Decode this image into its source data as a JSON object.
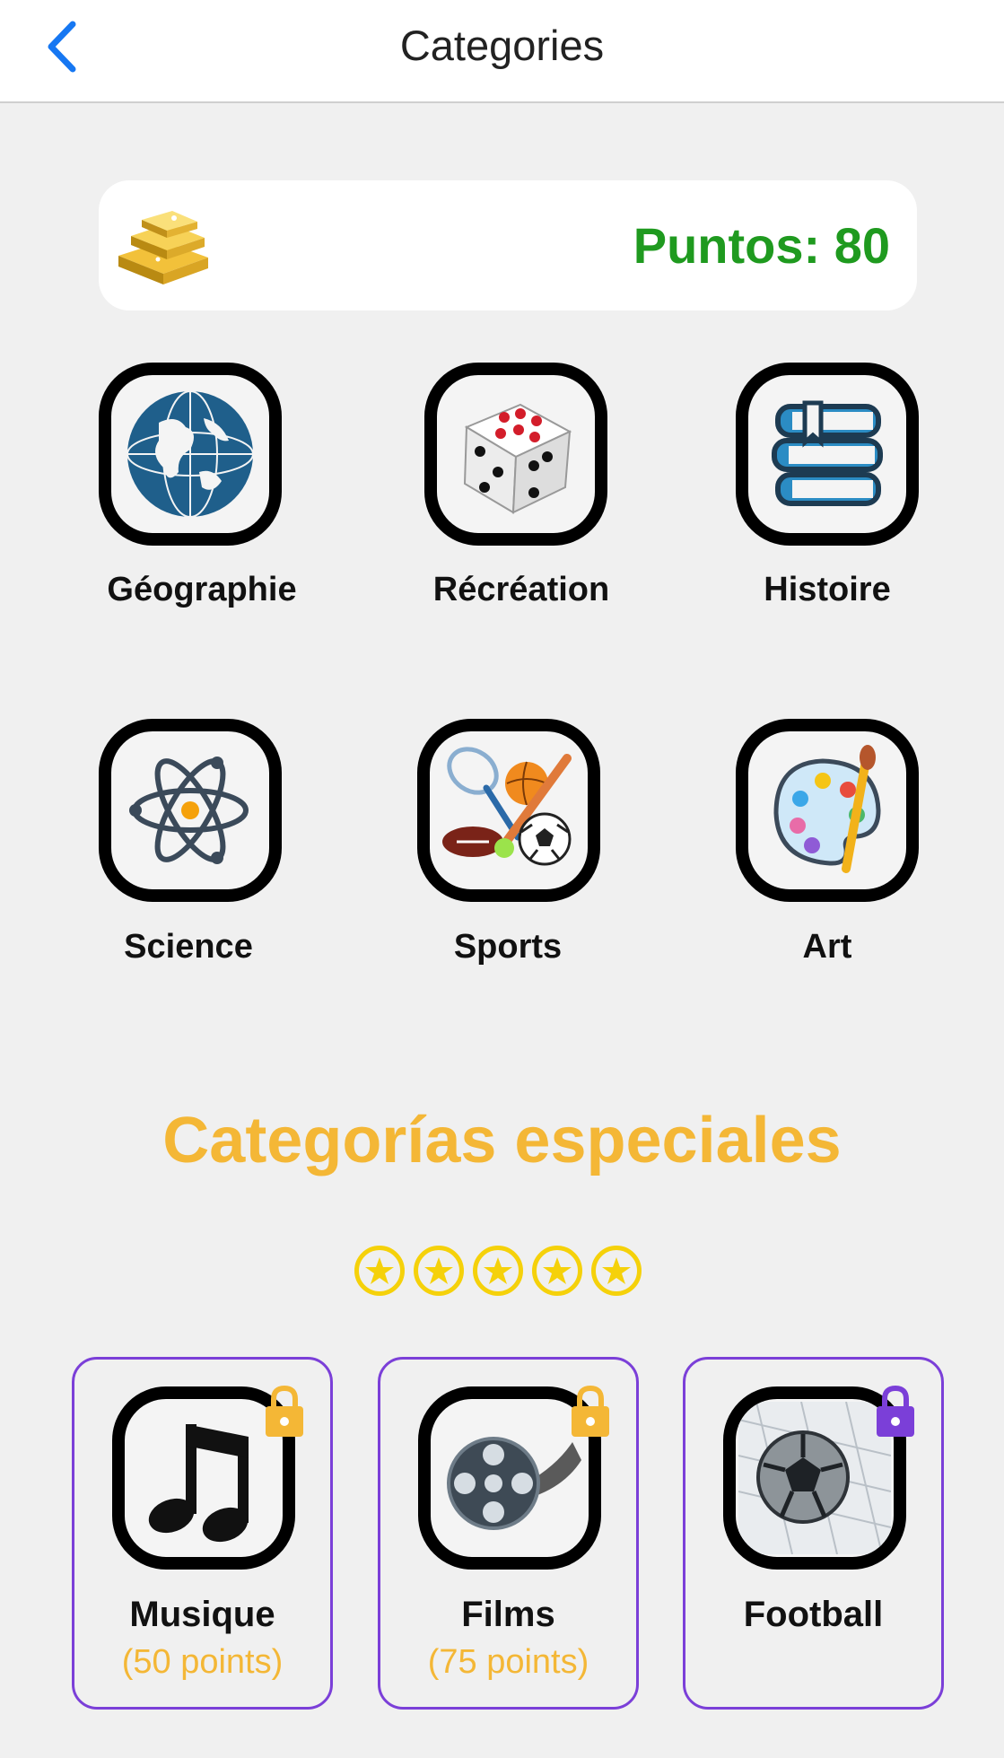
{
  "header": {
    "title": "Categories",
    "back_icon": "chevron-left-icon",
    "accent": "#1677f2"
  },
  "points": {
    "label": "Puntos: 80",
    "icon": "gold-bars-icon",
    "color": "#1f9a1f"
  },
  "categories": [
    {
      "label": "Géographie",
      "icon": "globe-icon"
    },
    {
      "label": "Récréation",
      "icon": "dice-icon"
    },
    {
      "label": "Histoire",
      "icon": "books-icon"
    },
    {
      "label": "Science",
      "icon": "atom-icon"
    },
    {
      "label": "Sports",
      "icon": "sports-balls-icon"
    },
    {
      "label": "Art",
      "icon": "palette-icon"
    }
  ],
  "special": {
    "title": "Categorías especiales",
    "title_color": "#f4b736",
    "stars_count": 5,
    "star_color": "#f5d10a",
    "items": [
      {
        "name": "Musique",
        "cost": "(50 points)",
        "icon": "music-note-icon",
        "lock_color": "#f4b736"
      },
      {
        "name": "Films",
        "cost": "(75 points)",
        "icon": "film-reel-icon",
        "lock_color": "#f4b736"
      },
      {
        "name": "Football",
        "cost": "",
        "icon": "soccer-ball-net-icon",
        "lock_color": "#7b3fd8"
      }
    ]
  }
}
